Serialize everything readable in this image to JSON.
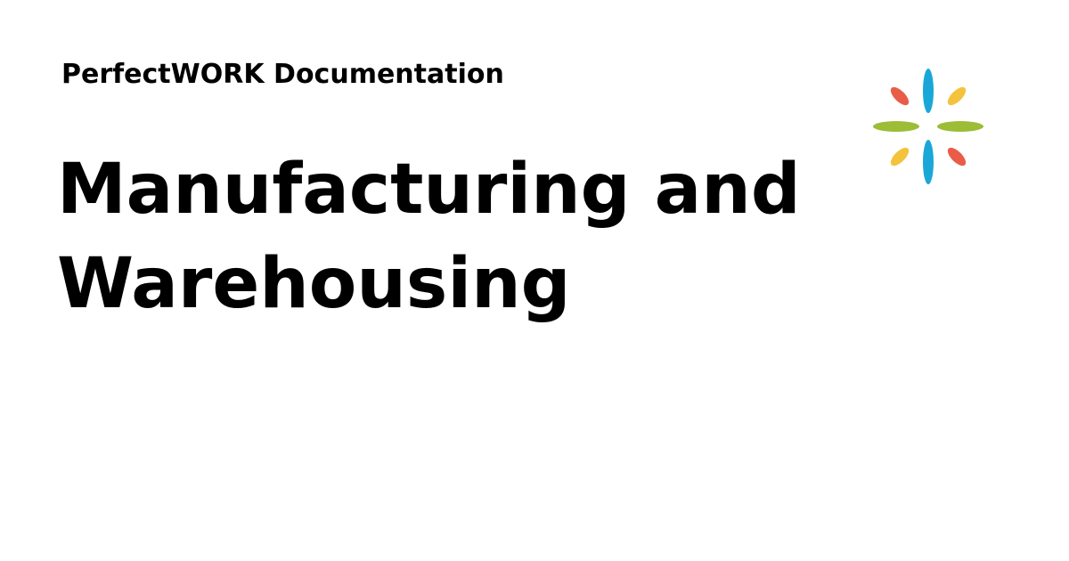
{
  "header": {
    "site_name": "PerfectWORK Documentation"
  },
  "main": {
    "title": "Manufacturing and Warehousing"
  },
  "logo": {
    "icon": "sparkle-logo-icon",
    "colors": {
      "blue": "#1aa7d8",
      "green": "#9cbd36",
      "yellow": "#f4c33d",
      "red": "#e95d48"
    }
  }
}
